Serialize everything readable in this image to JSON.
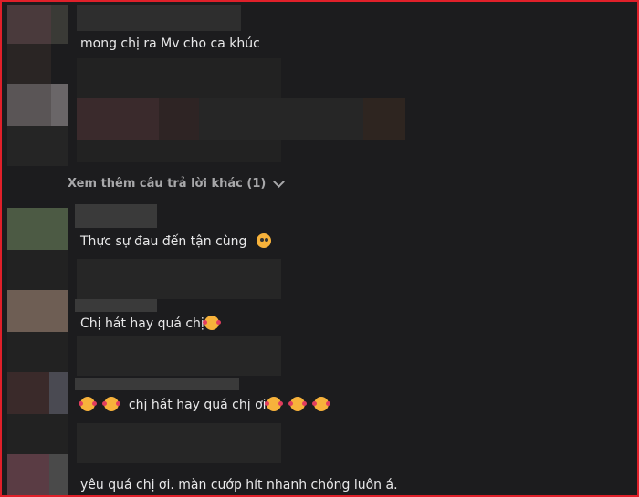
{
  "comments": [
    {
      "text": "mong chị ra Mv cho ca khúc",
      "emoji_before": [],
      "emoji_after": []
    },
    {
      "text": "Thực sự đau đến tận cùng",
      "emoji_before": [],
      "emoji_after": [
        "pleading-face"
      ]
    },
    {
      "text": "Chị hát hay quá chị",
      "emoji_before": [],
      "emoji_after": [
        "smiling-face-with-hearts"
      ]
    },
    {
      "text": "chị hát hay quá chị ơi",
      "emoji_before": [
        "smiling-face-with-hearts",
        "smiling-face-with-hearts"
      ],
      "emoji_after": [
        "smiling-face-with-hearts",
        "smiling-face-with-hearts",
        "smiling-face-with-hearts"
      ]
    },
    {
      "text": "yêu quá chị ơi. màn cướp hít nhanh chóng luôn á.",
      "emoji_before": [],
      "emoji_after": []
    }
  ],
  "replies_link": {
    "label": "Xem thêm câu trả lời khác (1)",
    "icon": "chevron-down-icon"
  },
  "colors": {
    "background": "#1c1c1e",
    "text": "#e9e9ea",
    "muted": "#a8a8aa",
    "border": "#e0202a"
  }
}
